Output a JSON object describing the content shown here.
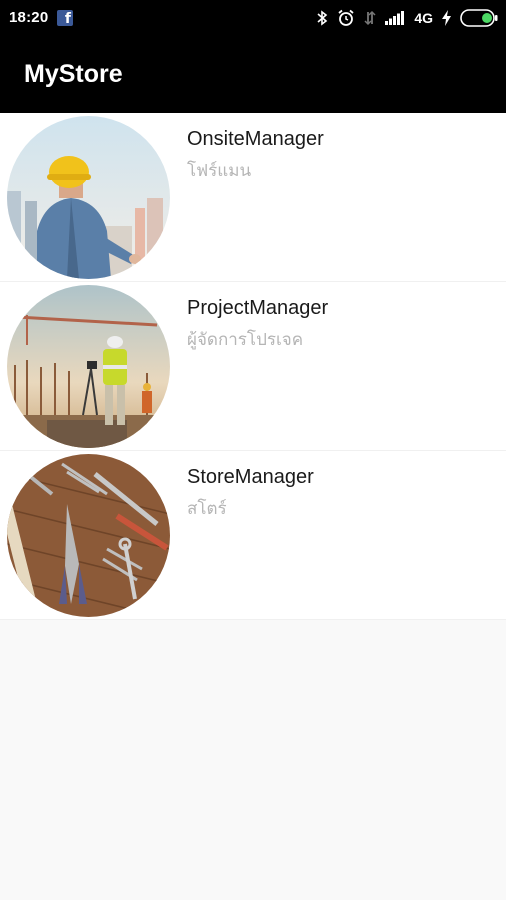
{
  "status_bar": {
    "time": "18:20",
    "network": "4G",
    "icons": [
      "facebook-icon",
      "bluetooth-icon",
      "alarm-icon",
      "data-transfer-icon",
      "signal-icon",
      "charging-icon",
      "battery-icon"
    ]
  },
  "app_bar": {
    "title": "MyStore"
  },
  "roles": [
    {
      "title": "OnsiteManager",
      "subtitle": "โฟร์แมน",
      "image": "worker-hardhat-city"
    },
    {
      "title": "ProjectManager",
      "subtitle": "ผู้จัดการโปรเจค",
      "image": "construction-site-crane"
    },
    {
      "title": "StoreManager",
      "subtitle": "สโตร์",
      "image": "tools-on-wood"
    }
  ],
  "colors": {
    "bar_bg": "#000000",
    "background": "#f9f9f9",
    "subtitle": "#b5b5b5",
    "battery_green": "#4cd964"
  }
}
